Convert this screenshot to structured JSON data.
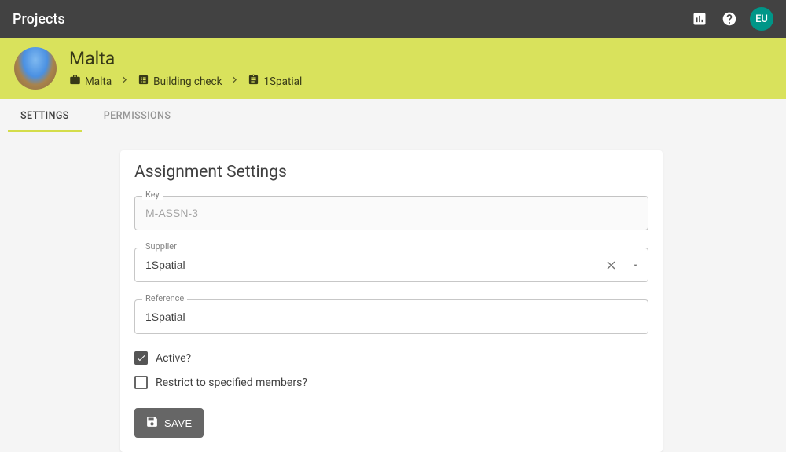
{
  "topbar": {
    "title": "Projects",
    "avatar_initials": "EU"
  },
  "header": {
    "title": "Malta"
  },
  "breadcrumbs": [
    {
      "icon": "briefcase",
      "label": "Malta"
    },
    {
      "icon": "list-box",
      "label": "Building check"
    },
    {
      "icon": "assignment",
      "label": "1Spatial"
    }
  ],
  "tabs": [
    {
      "label": "SETTINGS",
      "active": true
    },
    {
      "label": "PERMISSIONS",
      "active": false
    }
  ],
  "card": {
    "title": "Assignment Settings",
    "fields": {
      "key": {
        "label": "Key",
        "value": "M-ASSN-3",
        "disabled": true
      },
      "supplier": {
        "label": "Supplier",
        "value": "1Spatial"
      },
      "reference": {
        "label": "Reference",
        "value": "1Spatial"
      }
    },
    "checks": {
      "active": {
        "label": "Active?",
        "checked": true
      },
      "restrict": {
        "label": "Restrict to specified members?",
        "checked": false
      }
    },
    "save_label": "SAVE"
  }
}
